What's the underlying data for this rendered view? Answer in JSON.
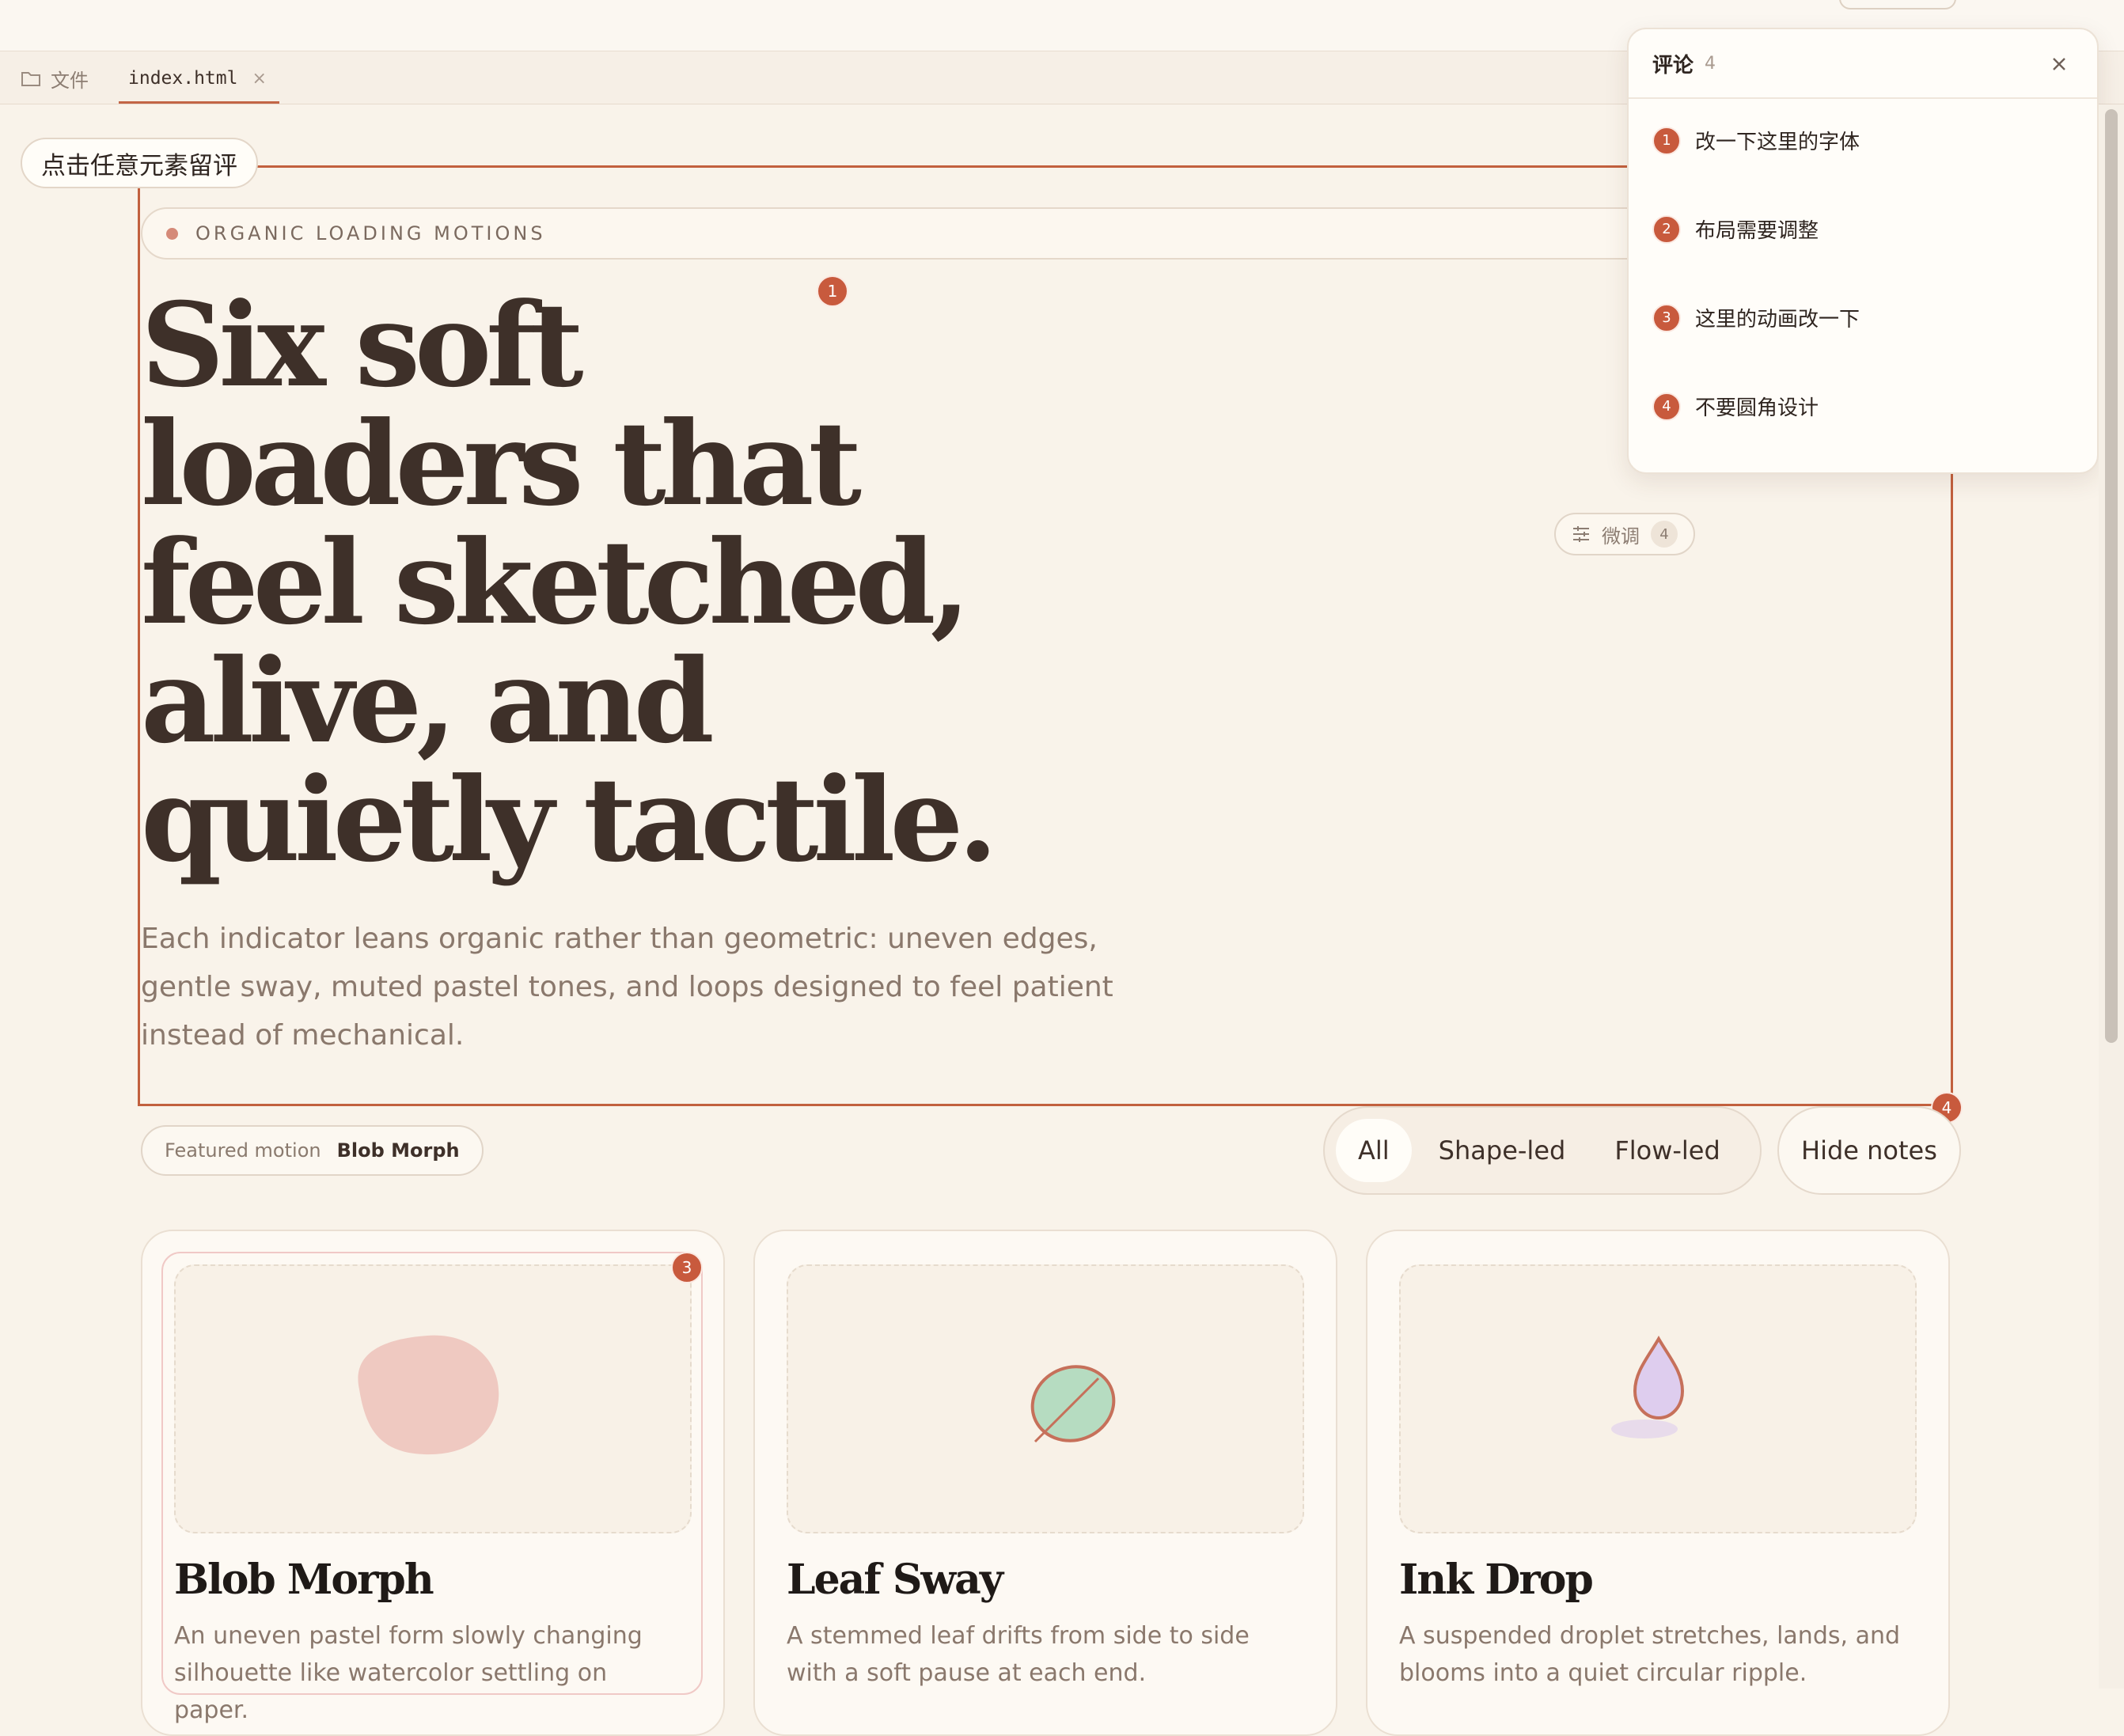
{
  "tabs": {
    "files_label": "文件",
    "file_name": "index.html",
    "close_glyph": "×"
  },
  "comment_hint": "点击任意元素留评",
  "hero": {
    "eyebrow": "ORGANIC LOADING MOTIONS",
    "headline": "Six soft\nloaders that\nfeel sketched,\nalive, and\nquietly tactile.",
    "lede": "Each indicator leans organic rather than geometric: uneven edges, gentle sway, muted pastel tones, and loops designed to feel patient instead of mechanical."
  },
  "pins": {
    "p1": "1",
    "p3": "3",
    "p4": "4"
  },
  "tweak": {
    "label": "微调",
    "count": "4"
  },
  "featured": {
    "label": "Featured motion",
    "value": "Blob Morph"
  },
  "filters": [
    "All",
    "Shape-led",
    "Flow-led"
  ],
  "hide_notes": "Hide notes",
  "cards": [
    {
      "title": "Blob Morph",
      "desc": "An uneven pastel form slowly changing silhouette like watercolor settling on paper.",
      "color": "#efc9c1"
    },
    {
      "title": "Leaf Sway",
      "desc": "A stemmed leaf drifts from side to side with a soft pause at each end.",
      "color": "#b6dcc1"
    },
    {
      "title": "Ink Drop",
      "desc": "A suspended droplet stretches, lands, and blooms into a quiet circular ripple.",
      "color": "#decdee"
    }
  ],
  "comments_panel": {
    "title": "评论",
    "count": "4",
    "items": [
      {
        "num": "1",
        "text": "改一下这里的字体"
      },
      {
        "num": "2",
        "text": "布局需要调整"
      },
      {
        "num": "3",
        "text": "这里的动画改一下"
      },
      {
        "num": "4",
        "text": "不要圆角设计"
      }
    ]
  },
  "colors": {
    "accent": "#c85a3d",
    "background": "#f9f3ea",
    "ink": "#3e3029"
  }
}
